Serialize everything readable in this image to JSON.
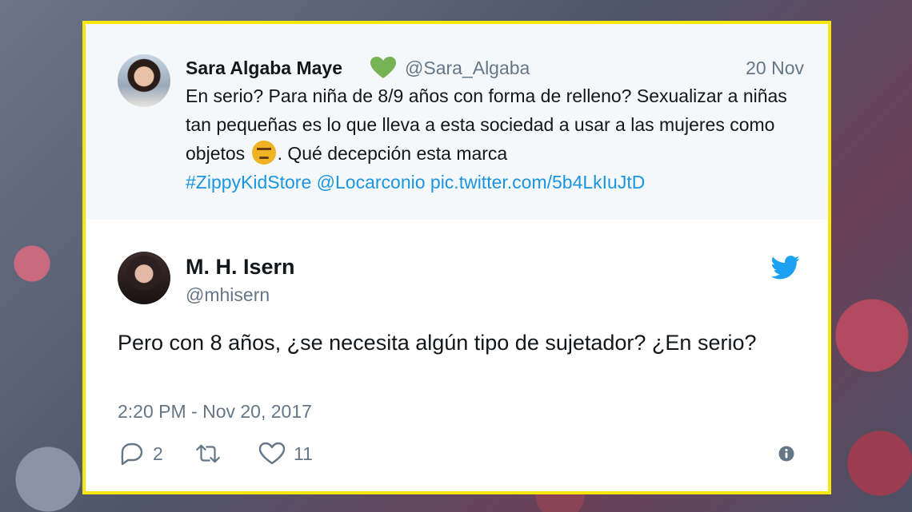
{
  "quoted_tweet": {
    "author_name": "Sara Algaba Maye",
    "badge_icon": "green-heart-icon",
    "handle": "@Sara_Algaba",
    "date": "20 Nov",
    "text_line_1": "En serio? Para niña de 8/9 años con forma de relleno? Sexualizar a niñas tan pequeñas es lo que lleva a esta sociedad a usar a las mujeres como objetos",
    "emoji": "angry-face-icon",
    "text_after_emoji": ". Qué decepción esta marca",
    "hashtag": "#ZippyKidStore",
    "mention": "@Locarconio",
    "pic_link": "pic.twitter.com/5b4LkIuJtD"
  },
  "tweet": {
    "author_name": "M. H. Isern",
    "handle": "@mhisern",
    "text": "Pero con 8 años, ¿se necesita algún tipo de sujetador? ¿En serio?",
    "timestamp": "2:20 PM - Nov 20, 2017",
    "reply_count": "2",
    "retweet_count": "",
    "like_count": "11"
  },
  "colors": {
    "frame_border": "#f5e70a",
    "link": "#1b95e0",
    "twitter_blue": "#1da1f2",
    "muted_text": "#657786",
    "quoted_bg": "#f5f8fa"
  }
}
